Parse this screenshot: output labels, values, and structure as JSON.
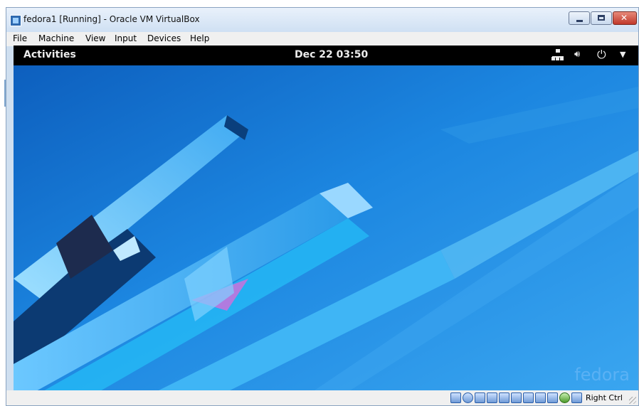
{
  "window": {
    "title": "fedora1 [Running] - Oracle VM VirtualBox",
    "icon": "virtualbox-icon"
  },
  "menubar": {
    "items": [
      "File",
      "Machine",
      "View",
      "Input",
      "Devices",
      "Help"
    ]
  },
  "guest": {
    "activities_label": "Activities",
    "clock": "Dec 22  03:50",
    "tray_icons": [
      "network-wired-icon",
      "volume-icon",
      "power-icon",
      "system-menu-arrow-icon"
    ],
    "wallpaper_logo": "fedora"
  },
  "statusbar": {
    "indicator_icons": [
      "hard-disk-icon",
      "optical-drive-icon",
      "audio-icon",
      "network-icon",
      "usb-icon",
      "shared-folders-icon",
      "display-icon",
      "video-capture-icon",
      "cpu-icon",
      "mouse-integration-icon",
      "keyboard-icon"
    ],
    "host_key": "Right Ctrl"
  },
  "colors": {
    "gnome_topbar": "#000000",
    "wallpaper_blue": "#1f7fd6"
  }
}
